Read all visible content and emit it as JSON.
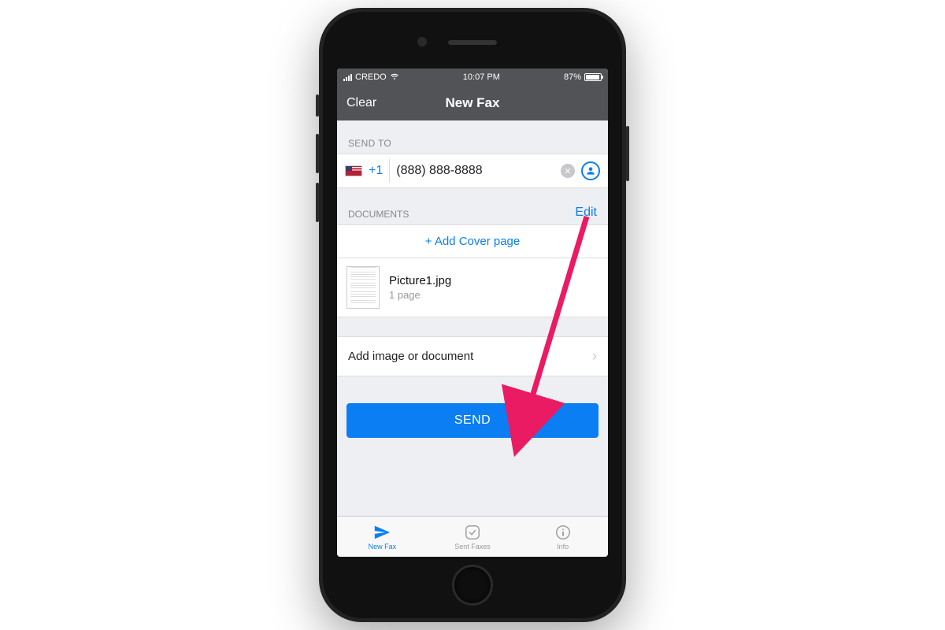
{
  "status": {
    "carrier": "CREDO",
    "time": "10:07 PM",
    "battery": "87%"
  },
  "nav": {
    "left": "Clear",
    "title": "New Fax"
  },
  "send_to": {
    "label": "SEND TO",
    "country_code": "+1",
    "phone": "(888) 888-8888"
  },
  "documents": {
    "label": "DOCUMENTS",
    "edit": "Edit",
    "add_cover": "+ Add Cover page",
    "items": [
      {
        "name": "Picture1.jpg",
        "pages": "1 page"
      }
    ],
    "add_more": "Add image or document"
  },
  "send_button": "SEND",
  "tabs": [
    {
      "label": "New Fax",
      "icon": "send"
    },
    {
      "label": "Sent Faxes",
      "icon": "check"
    },
    {
      "label": "Info",
      "icon": "info"
    }
  ]
}
